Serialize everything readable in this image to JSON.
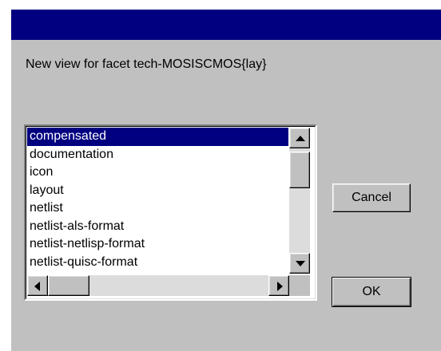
{
  "window": {
    "title": ""
  },
  "prompt": "New view for facet tech-MOSISCMOS{lay}",
  "list": {
    "selected_index": 0,
    "items": [
      "compensated",
      "documentation",
      "icon",
      "layout",
      "netlist",
      "netlist-als-format",
      "netlist-netlisp-format",
      "netlist-quisc-format"
    ]
  },
  "buttons": {
    "cancel": "Cancel",
    "ok": "OK"
  },
  "icons": {
    "scroll_up": "arrow-up-icon",
    "scroll_down": "arrow-down-icon",
    "scroll_left": "arrow-left-icon",
    "scroll_right": "arrow-right-icon"
  },
  "colors": {
    "title_bar": "#000080",
    "dialog_face": "#c0c0c0",
    "selection": "#000080"
  }
}
